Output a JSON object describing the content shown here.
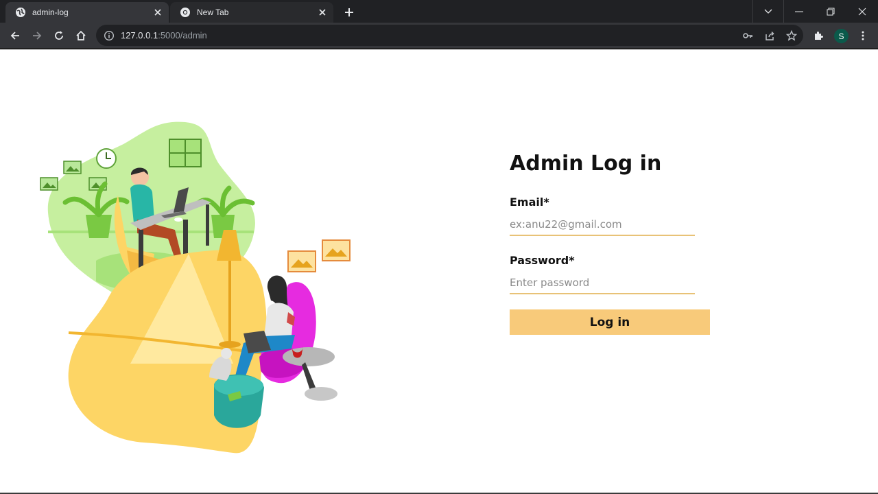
{
  "browser": {
    "tabs": [
      {
        "title": "admin-log",
        "active": true,
        "icon": "globe-icon"
      },
      {
        "title": "New Tab",
        "active": false,
        "icon": "chrome-icon"
      }
    ],
    "url_host": "127.0.0.1",
    "url_rest": ":5000/admin",
    "profile_initial": "S"
  },
  "login": {
    "heading": "Admin Log in",
    "email_label": "Email*",
    "email_placeholder": "ex:anu22@gmail.com",
    "password_label": "Password*",
    "password_placeholder": "Enter password",
    "submit_label": "Log in"
  },
  "colors": {
    "accent": "#f8ca7a",
    "underline": "#e8c277",
    "illustration_green": "#c6ef9f",
    "illustration_yellow": "#fdd565"
  }
}
